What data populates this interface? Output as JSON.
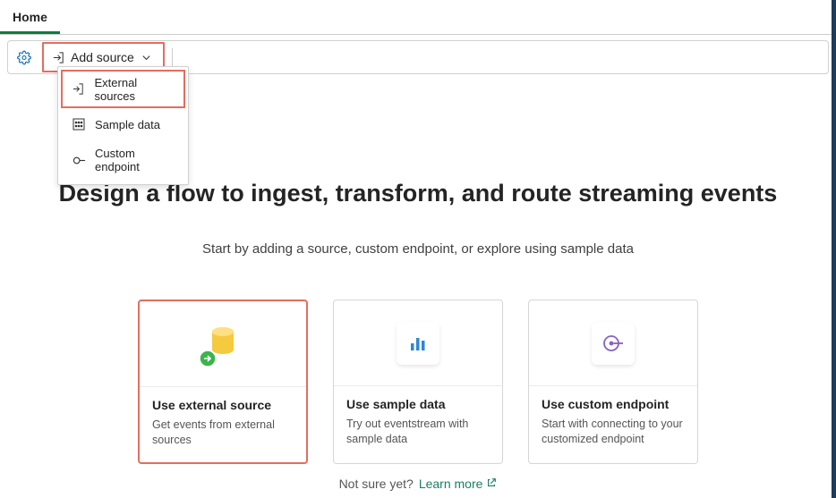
{
  "tabs": {
    "home": "Home"
  },
  "toolbar": {
    "add_source_label": "Add source"
  },
  "dropdown": {
    "items": [
      {
        "label": "External sources"
      },
      {
        "label": "Sample data"
      },
      {
        "label": "Custom endpoint"
      }
    ]
  },
  "main": {
    "headline": "Design a flow to ingest, transform, and route streaming events",
    "subhead": "Start by adding a source, custom endpoint, or explore using sample data"
  },
  "cards": [
    {
      "title": "Use external source",
      "desc": "Get events from external sources"
    },
    {
      "title": "Use sample data",
      "desc": "Try out eventstream with sample data"
    },
    {
      "title": "Use custom endpoint",
      "desc": "Start with connecting to your customized endpoint"
    }
  ],
  "footer": {
    "prompt": "Not sure yet?",
    "learn_more": "Learn more"
  },
  "colors": {
    "highlight": "#e46d5f",
    "accent_green": "#0f7b3e",
    "link_teal": "#1a7f64"
  }
}
